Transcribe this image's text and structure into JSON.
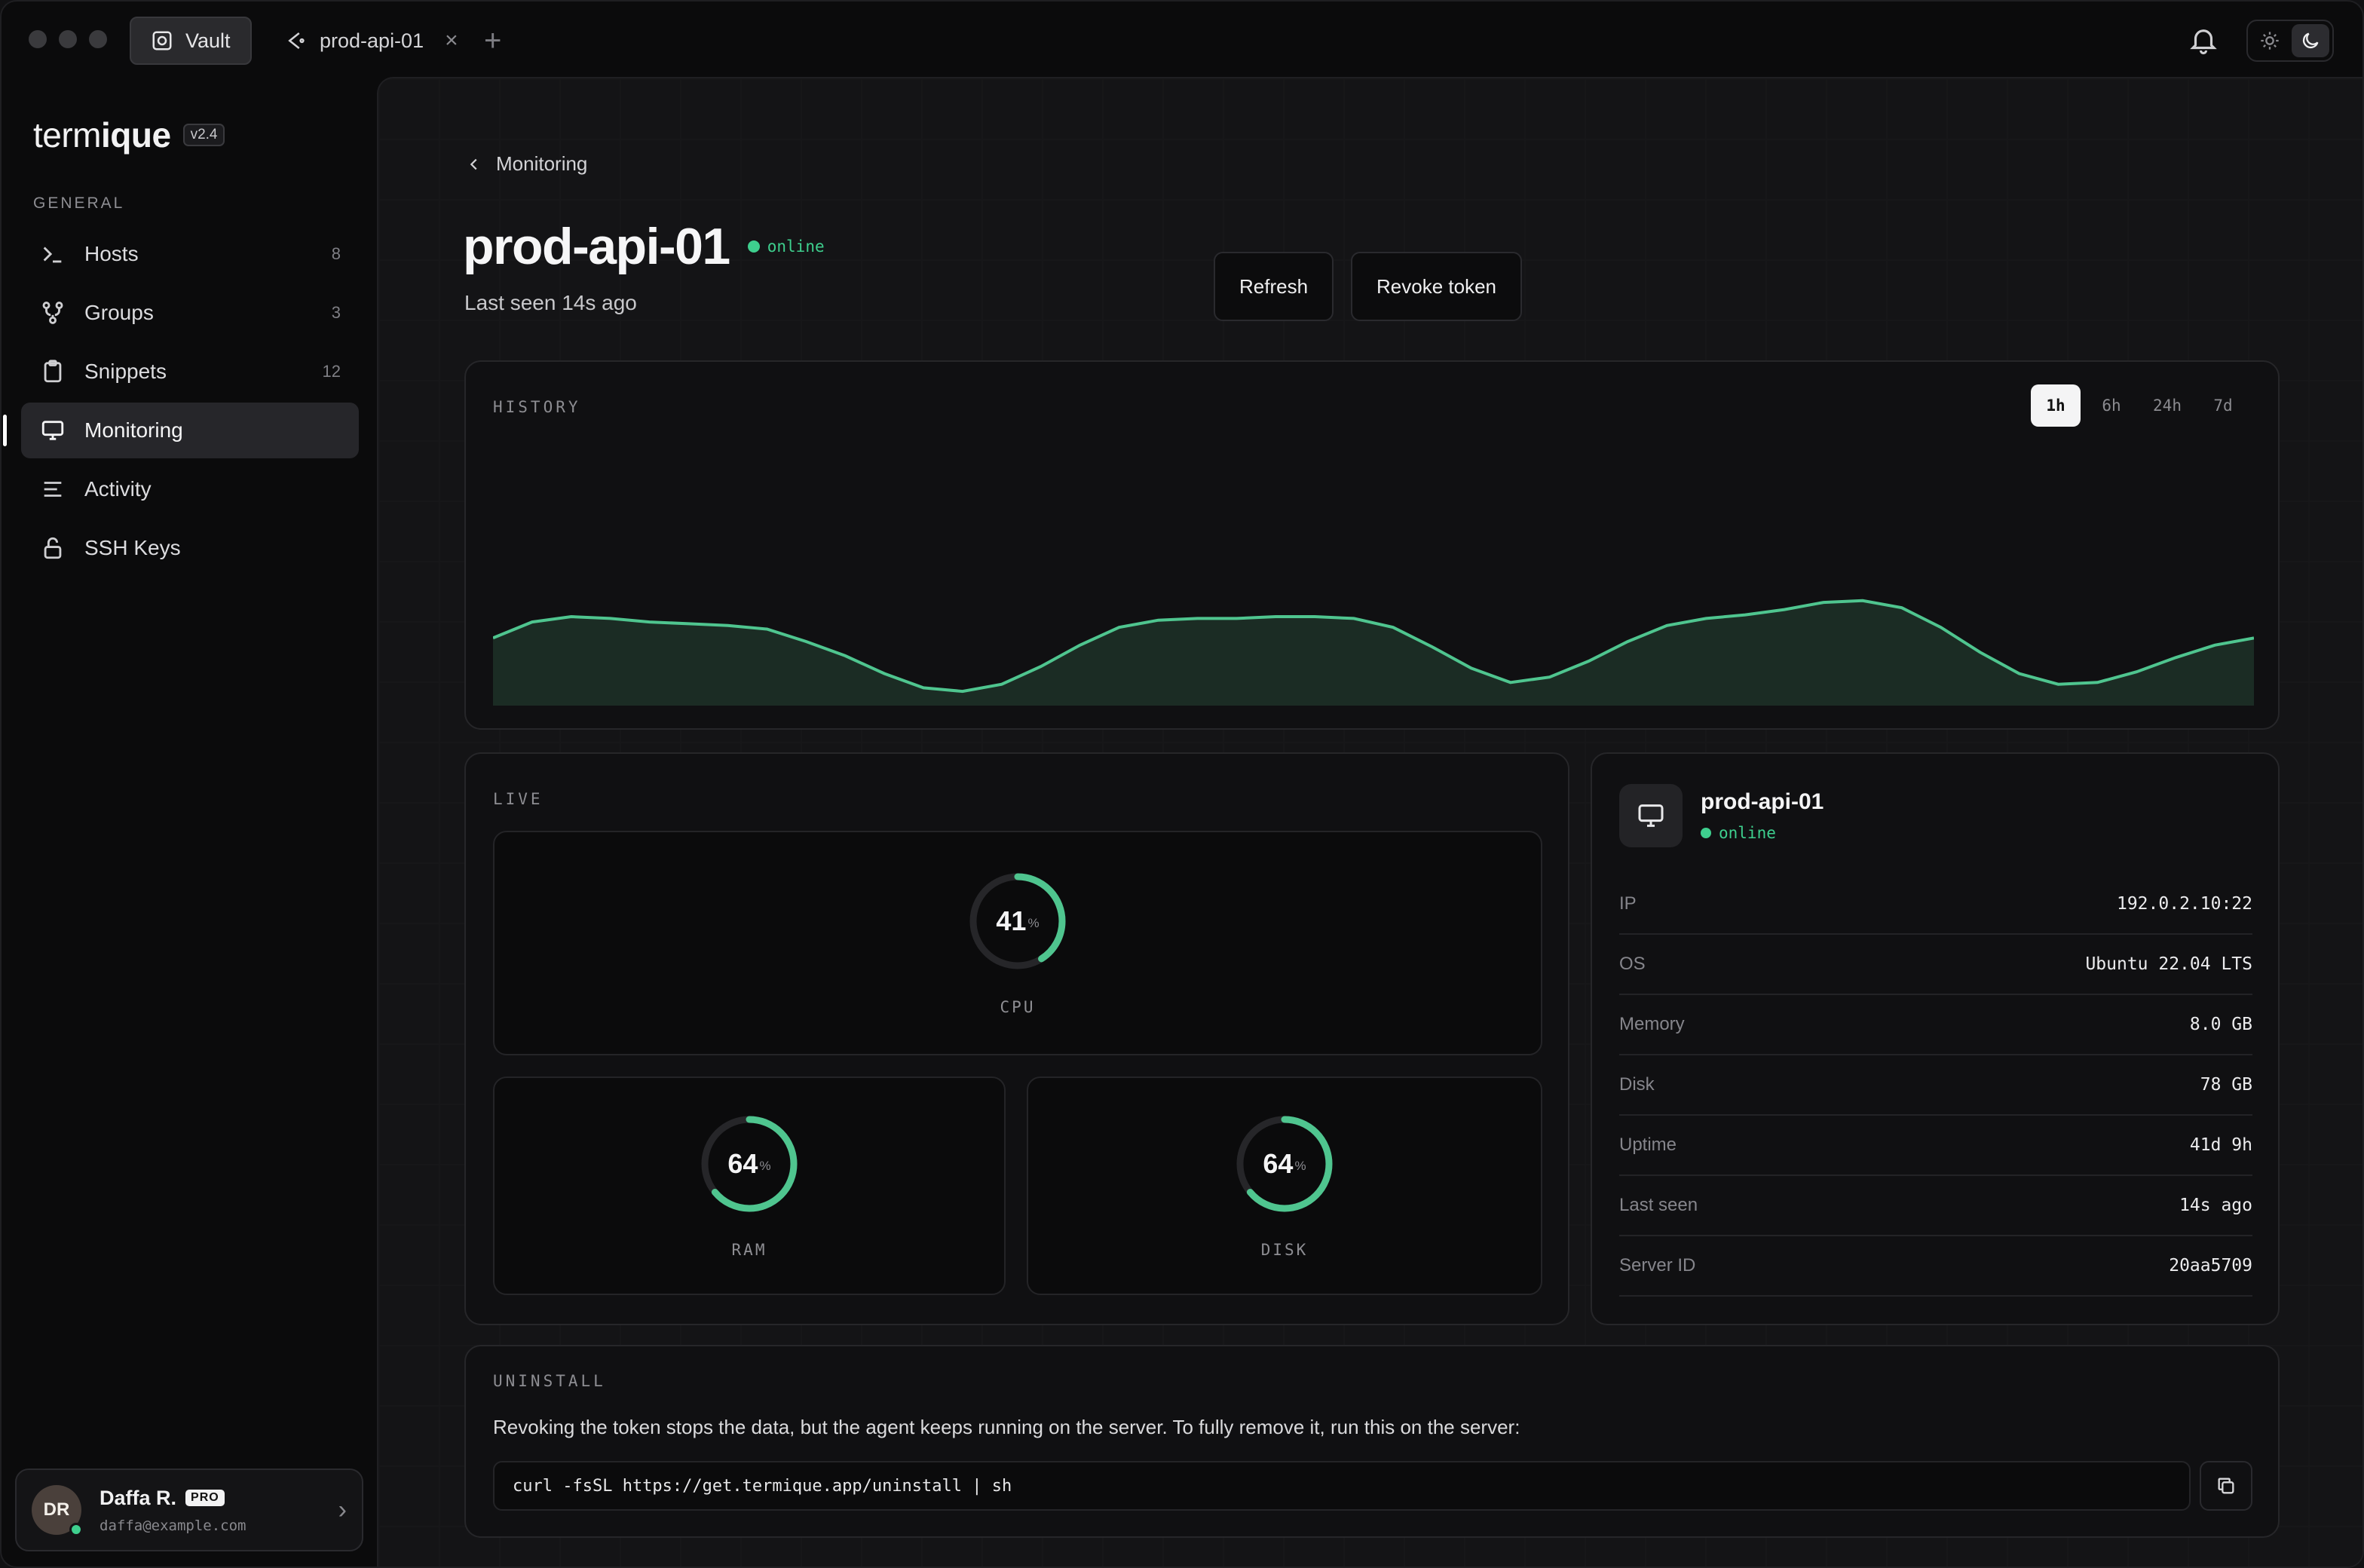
{
  "window": {
    "tabs": [
      {
        "label": "Vault",
        "icon": "vault-icon",
        "active": true
      },
      {
        "label": "prod-api-01",
        "icon": "server-tab-icon",
        "active": false,
        "close": "×"
      }
    ],
    "new_tab": "+"
  },
  "sidebar": {
    "brand": {
      "prefix": "term",
      "bold": "ique",
      "version": "v2.4"
    },
    "section": "GENERAL",
    "items": [
      {
        "label": "Hosts",
        "count": "8",
        "icon": "terminal-icon"
      },
      {
        "label": "Groups",
        "count": "3",
        "icon": "groups-icon"
      },
      {
        "label": "Snippets",
        "count": "12",
        "icon": "clipboard-icon"
      },
      {
        "label": "Monitoring",
        "count": "",
        "icon": "monitor-icon",
        "active": true
      },
      {
        "label": "Activity",
        "count": "",
        "icon": "activity-icon"
      },
      {
        "label": "SSH Keys",
        "count": "",
        "icon": "lock-icon"
      }
    ],
    "user": {
      "initials": "DR",
      "name": "Daffa R.",
      "badge": "PRO",
      "email": "daffa@example.com"
    }
  },
  "main": {
    "breadcrumb": "Monitoring",
    "title": "prod-api-01",
    "status": "online",
    "subtitle": "Last seen 14s ago",
    "buttons": {
      "refresh": "Refresh",
      "revoke": "Revoke token"
    },
    "history": {
      "label": "HISTORY",
      "ranges": [
        "1h",
        "6h",
        "24h",
        "7d"
      ],
      "selected_range": "1h"
    },
    "live": {
      "label": "LIVE",
      "percent_sign": "%",
      "cpu": {
        "value": "41",
        "label": "CPU",
        "fraction": 0.41
      },
      "ram": {
        "value": "64",
        "label": "RAM",
        "fraction": 0.64
      },
      "disk": {
        "value": "64",
        "label": "DISK",
        "fraction": 0.64
      }
    },
    "info": {
      "name": "prod-api-01",
      "status": "online",
      "rows": [
        {
          "key": "IP",
          "value": "192.0.2.10:22"
        },
        {
          "key": "OS",
          "value": "Ubuntu 22.04 LTS"
        },
        {
          "key": "Memory",
          "value": "8.0 GB"
        },
        {
          "key": "Disk",
          "value": "78 GB"
        },
        {
          "key": "Uptime",
          "value": "41d 9h"
        },
        {
          "key": "Last seen",
          "value": "14s ago"
        },
        {
          "key": "Server ID",
          "value": "20aa5709"
        }
      ]
    },
    "uninstall": {
      "label": "UNINSTALL",
      "text": "Revoking the token stops the data, but the agent keeps running on the server. To fully remove it, run this on the server:",
      "command": "curl -fsSL https://get.termique.app/uninstall | sh"
    }
  },
  "colors": {
    "accent": "#3ecf8e",
    "background": "#0b0b0c",
    "panel": "#101012"
  },
  "chart_data": {
    "type": "area",
    "title": "",
    "xlabel": "",
    "ylabel": "",
    "ylim": [
      0,
      100
    ],
    "grid": false,
    "series": [
      {
        "values": [
          38,
          47,
          50,
          49,
          47,
          46,
          45,
          43,
          36,
          28,
          18,
          10,
          8,
          12,
          22,
          34,
          44,
          48,
          49,
          49,
          50,
          50,
          49,
          44,
          33,
          21,
          13,
          16,
          25,
          36,
          45,
          49,
          51,
          54,
          58,
          59,
          55,
          44,
          30,
          18,
          12,
          13,
          19,
          27,
          34,
          38
        ]
      }
    ]
  }
}
